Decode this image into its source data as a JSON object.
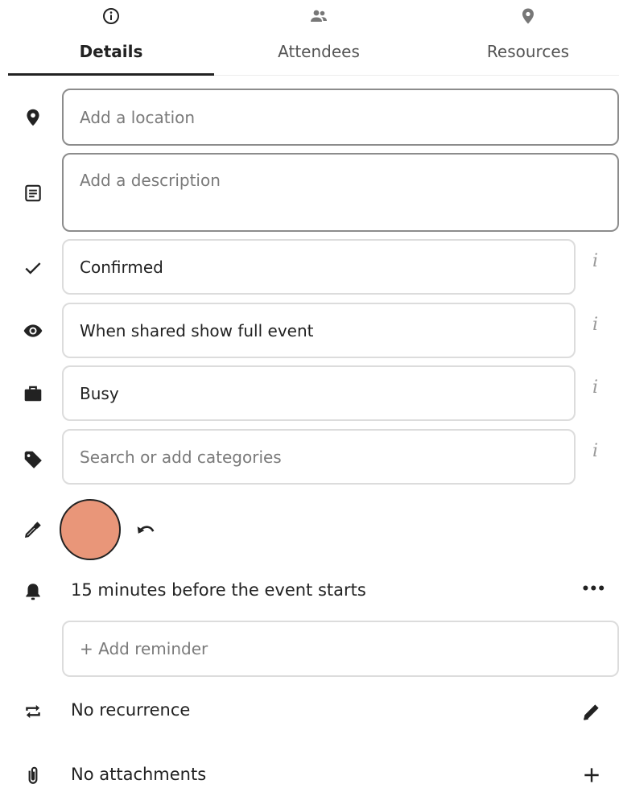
{
  "tabs": [
    {
      "label": "Details",
      "icon": "info-icon",
      "active": true
    },
    {
      "label": "Attendees",
      "icon": "people-icon",
      "active": false
    },
    {
      "label": "Resources",
      "icon": "map-marker-icon",
      "active": false
    }
  ],
  "details": {
    "location_placeholder": "Add a location",
    "description_placeholder": "Add a description",
    "status_value": "Confirmed",
    "visibility_value": "When shared show full event",
    "availability_value": "Busy",
    "categories_placeholder": "Search or add categories",
    "info_glyph": "i",
    "event_color": "#e99679",
    "reminder_text": "15 minutes before the event starts",
    "reminder_more": "•••",
    "add_reminder_placeholder": "+ Add reminder",
    "recurrence_text": "No recurrence",
    "attachments_text": "No attachments"
  }
}
